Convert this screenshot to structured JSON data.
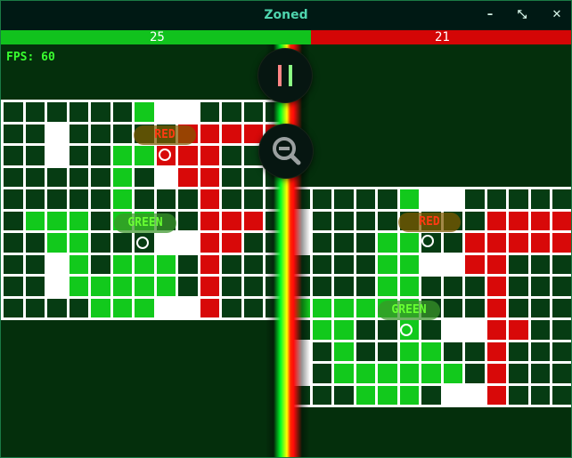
{
  "window": {
    "title": "Zoned",
    "minimize_glyph": "–",
    "maximize_glyph": "⤡",
    "close_glyph": "✕"
  },
  "scores": {
    "green": "25",
    "red": "21"
  },
  "status": {
    "fps": "FPS: 60"
  },
  "controls": {
    "pause_icon": "pause-icon",
    "zoom_out_icon": "zoom-out-icon"
  },
  "colors": {
    "green": "#12c91c",
    "red": "#d80909",
    "dark": "#063c13",
    "white": "#ffffff"
  },
  "boards": [
    {
      "label_red": "RED",
      "label_green": "GREEN",
      "rows": [
        "DDDDDDGWWDDDD",
        "DDWDDDDDRRRRR",
        "DDWDDGGRRRDDD",
        "DDDDDGDWRRDDD",
        "DDDDDGDDDRDDD",
        "DGGGDGGDDRRRD",
        "DDGGDDDWWRRDD",
        "DDWGDGGGDRDDD",
        "DDWGGGGGDRDDD",
        "DDDDGGGWWRDDD"
      ]
    },
    {
      "label_red": "RED",
      "label_green": "GREEN",
      "rows": [
        "DDDDDGWWDDDDD",
        "WDDDDDDDDRRRR",
        "WDDDGGDDRRRRR",
        "DDDDGGWWRRDDD",
        "DDDDGGDDDRDDD",
        "GGGGGGDDDRDDD",
        "DGGDDGDWWRRDD",
        "WDGDDGGDDRDDD",
        "WDGGGGGGDRDDD",
        "DDDGGGDWWRDDD"
      ]
    }
  ]
}
